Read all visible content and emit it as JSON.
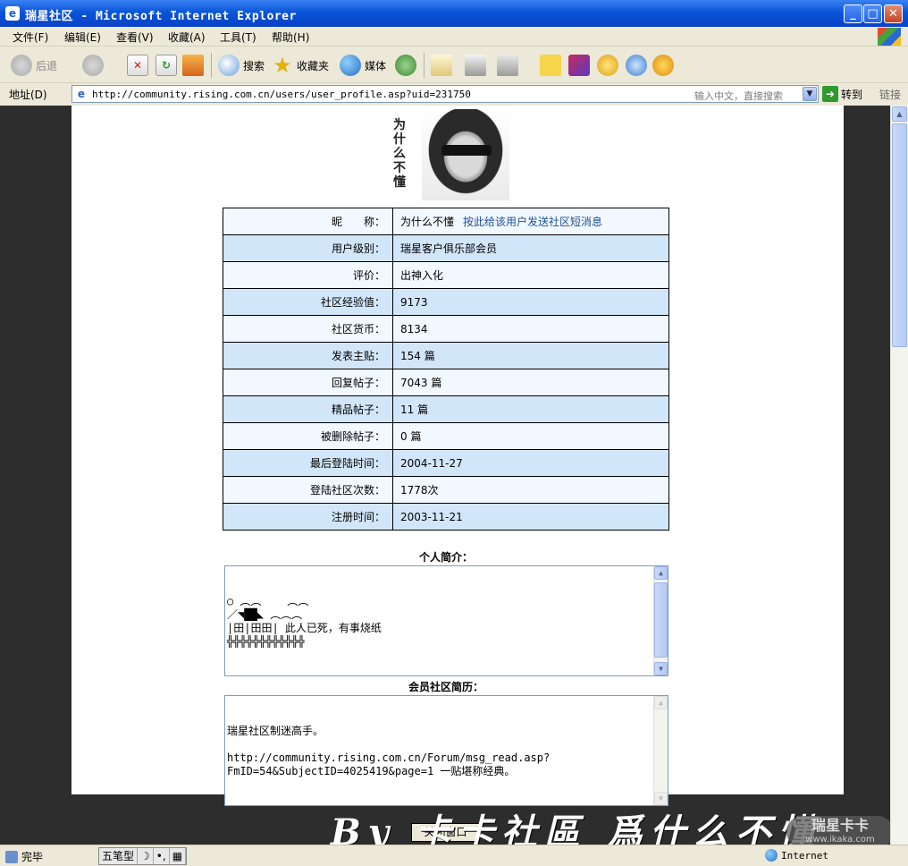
{
  "window": {
    "title": "瑞星社区 - Microsoft Internet Explorer",
    "controls": {
      "minimize": "_",
      "maximize": "□",
      "close": "✕"
    }
  },
  "menu": [
    "文件(F)",
    "编辑(E)",
    "查看(V)",
    "收藏(A)",
    "工具(T)",
    "帮助(H)"
  ],
  "toolbar": {
    "back": "后退",
    "search": "搜索",
    "favorites": "收藏夹",
    "media": "媒体"
  },
  "address": {
    "label": "地址(D)",
    "url": "http://community.rising.com.cn/users/user_profile.asp?uid=231750",
    "search_hint": "输入中文，直接搜索",
    "go": "转到",
    "links": "链接"
  },
  "avatar": {
    "caption": "为什么不懂"
  },
  "profile": {
    "rows": [
      {
        "key": "昵　　称：",
        "value": "为什么不懂"
      },
      {
        "key": "用户级别：",
        "value": "瑞星客户俱乐部会员"
      },
      {
        "key": "评价：",
        "value": "出神入化"
      },
      {
        "key": "社区经验值：",
        "value": "9173"
      },
      {
        "key": "社区货币：",
        "value": "8134"
      },
      {
        "key": "发表主贴：",
        "value": "154 篇"
      },
      {
        "key": "回复帖子：",
        "value": "7043 篇"
      },
      {
        "key": "精品帖子：",
        "value": "11 篇"
      },
      {
        "key": "被删除帖子：",
        "value": "0 篇"
      },
      {
        "key": "最后登陆时间：",
        "value": "2004-11-27"
      },
      {
        "key": "登陆社区次数：",
        "value": "1778次"
      },
      {
        "key": "注册时间：",
        "value": "2003-11-21"
      }
    ],
    "message_link": "按此给该用户发送社区短消息"
  },
  "intro": {
    "title": "个人简介：",
    "text": "○ ︵︵    ︵︵\n／◥██◣ ︵︵︵\n|田|田田| 此人已死，有事烧纸\n╬╬╬╬╬╬╬╬╬╬╬╬\n\n\n欢迎光临“逍遥谷”看其尸体！\nhttp://www.tylj.com/"
  },
  "history": {
    "title": "会员社区简历：",
    "text": "瑞星社区制迷高手。\n\nhttp://community.rising.com.cn/Forum/msg_read.asp?\nFmID=54&SubjectID=4025419&page=1 一贴堪称经典。"
  },
  "close_button": "关闭窗口",
  "watermark": {
    "text": "By 卡卡社區  爲什么不懂",
    "logo": "瑞星卡卡",
    "logo_url": "www.ikaka.com"
  },
  "status": {
    "done": "完毕",
    "ime": [
      "五笔型",
      "☽",
      "•,",
      "▦"
    ],
    "zone": "Internet"
  }
}
